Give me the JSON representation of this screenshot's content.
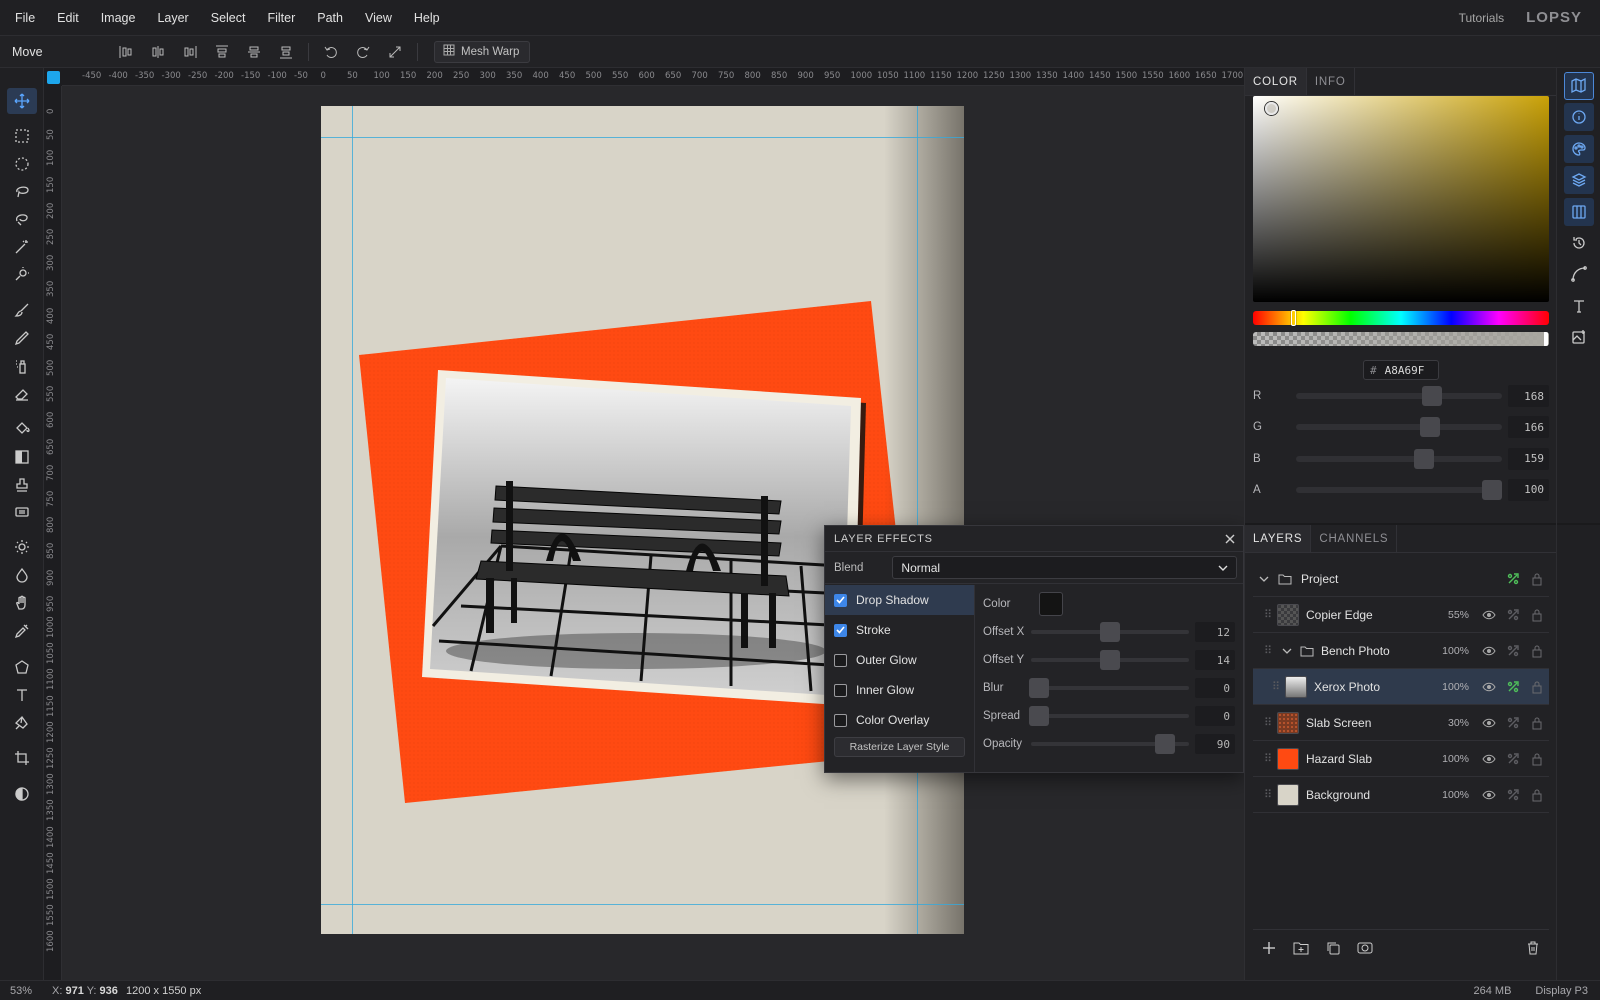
{
  "menu": [
    "File",
    "Edit",
    "Image",
    "Layer",
    "Select",
    "Filter",
    "Path",
    "View",
    "Help"
  ],
  "header": {
    "tutorials": "Tutorials",
    "logo": "LOPSY"
  },
  "options": {
    "tool_name": "Move",
    "mesh_warp": "Mesh Warp"
  },
  "toolbar": [
    "move-icon",
    "rect-select-icon",
    "ellipse-select-icon",
    "lasso-icon",
    "magnetic-lasso-icon",
    "magic-wand-icon",
    "quick-select-icon",
    "brush-icon",
    "pencil-icon",
    "spray-icon",
    "eraser-icon",
    "bucket-icon",
    "gradient-icon",
    "stamp-icon",
    "patch-icon",
    "dodge-icon",
    "blur-drop-icon",
    "hand-icon",
    "eyedropper-icon",
    "polygon-icon",
    "text-icon",
    "pen-icon",
    "crop-icon",
    "contrast-icon"
  ],
  "rulers": {
    "h": [
      "-450",
      "-400",
      "-350",
      "-300",
      "-250",
      "-200",
      "-150",
      "-100",
      "-50",
      "0",
      "50",
      "100",
      "150",
      "200",
      "250",
      "300",
      "350",
      "400",
      "450",
      "500",
      "550",
      "600",
      "650",
      "700",
      "750",
      "800",
      "850",
      "900",
      "950",
      "1000",
      "1050",
      "1100",
      "1150",
      "1200",
      "1250",
      "1300",
      "1350",
      "1400",
      "1450",
      "1500",
      "1550",
      "1600",
      "1650",
      "1700"
    ],
    "v": [
      "0",
      "50",
      "100",
      "150",
      "200",
      "250",
      "300",
      "350",
      "400",
      "450",
      "500",
      "550",
      "600",
      "650",
      "700",
      "750",
      "800",
      "850",
      "900",
      "950",
      "1000",
      "1050",
      "1100",
      "1150",
      "1200",
      "1250",
      "1300",
      "1350",
      "1400",
      "1450",
      "1500",
      "1550",
      "1600"
    ]
  },
  "status": {
    "zoom": "53%",
    "x_label": "X:",
    "x": "971",
    "y_label": "Y:",
    "y": "936",
    "doc_size": "1200 x 1550 px",
    "memory": "264 MB",
    "profile": "Display P3"
  },
  "effects": {
    "title": "LAYER EFFECTS",
    "blend_label": "Blend",
    "blend_value": "Normal",
    "items": [
      {
        "label": "Drop Shadow",
        "checked": true
      },
      {
        "label": "Stroke",
        "checked": true
      },
      {
        "label": "Outer Glow",
        "checked": false
      },
      {
        "label": "Inner Glow",
        "checked": false
      },
      {
        "label": "Color Overlay",
        "checked": false
      }
    ],
    "rasterize": "Rasterize Layer Style",
    "color_label": "Color",
    "shadow_color": "#141414",
    "props": [
      {
        "label": "Offset X",
        "value": "12",
        "level": 0.5
      },
      {
        "label": "Offset Y",
        "value": "14",
        "level": 0.5
      },
      {
        "label": "Blur",
        "value": "0",
        "level": 0.05
      },
      {
        "label": "Spread",
        "value": "0",
        "level": 0.05
      },
      {
        "label": "Opacity",
        "value": "90",
        "level": 0.85
      }
    ]
  },
  "color_panel": {
    "tabs": [
      "COLOR",
      "INFO"
    ],
    "hex": "A8A69F",
    "hex_prefix": "#",
    "hue_level": 0.13,
    "channels": [
      {
        "label": "R",
        "value": "168",
        "level": 0.66
      },
      {
        "label": "G",
        "value": "166",
        "level": 0.65
      },
      {
        "label": "B",
        "value": "159",
        "level": 0.62
      },
      {
        "label": "A",
        "value": "100",
        "level": 0.95
      }
    ]
  },
  "layers_panel": {
    "tabs": [
      "LAYERS",
      "CHANNELS"
    ],
    "project": "Project",
    "layers": [
      {
        "name": "Copier Edge",
        "opacity": "55%",
        "indent": 0,
        "thumb": "checker"
      },
      {
        "name": "Bench Photo",
        "opacity": "100%",
        "indent": 0,
        "thumb": "folder"
      },
      {
        "name": "Xerox Photo",
        "opacity": "100%",
        "indent": 1,
        "thumb": "photo",
        "selected": true,
        "fx": true
      },
      {
        "name": "Slab Screen",
        "opacity": "30%",
        "indent": 0,
        "thumb": "orange-screen"
      },
      {
        "name": "Hazard Slab",
        "opacity": "100%",
        "indent": 0,
        "thumb": "orange"
      },
      {
        "name": "Background",
        "opacity": "100%",
        "indent": 0,
        "thumb": "cream"
      }
    ]
  },
  "icon_strip": [
    "map-icon",
    "info-icon",
    "palette-icon",
    "layers-icon",
    "channels-icon",
    "history-icon",
    "curve-icon",
    "type-icon",
    "image-add-icon"
  ],
  "colors": {
    "accent": "#3d86e8",
    "guide": "#37a9db",
    "hazard": "#ff4a12",
    "paper": "#d8d4c8",
    "fx_green": "#4fbf5a"
  }
}
